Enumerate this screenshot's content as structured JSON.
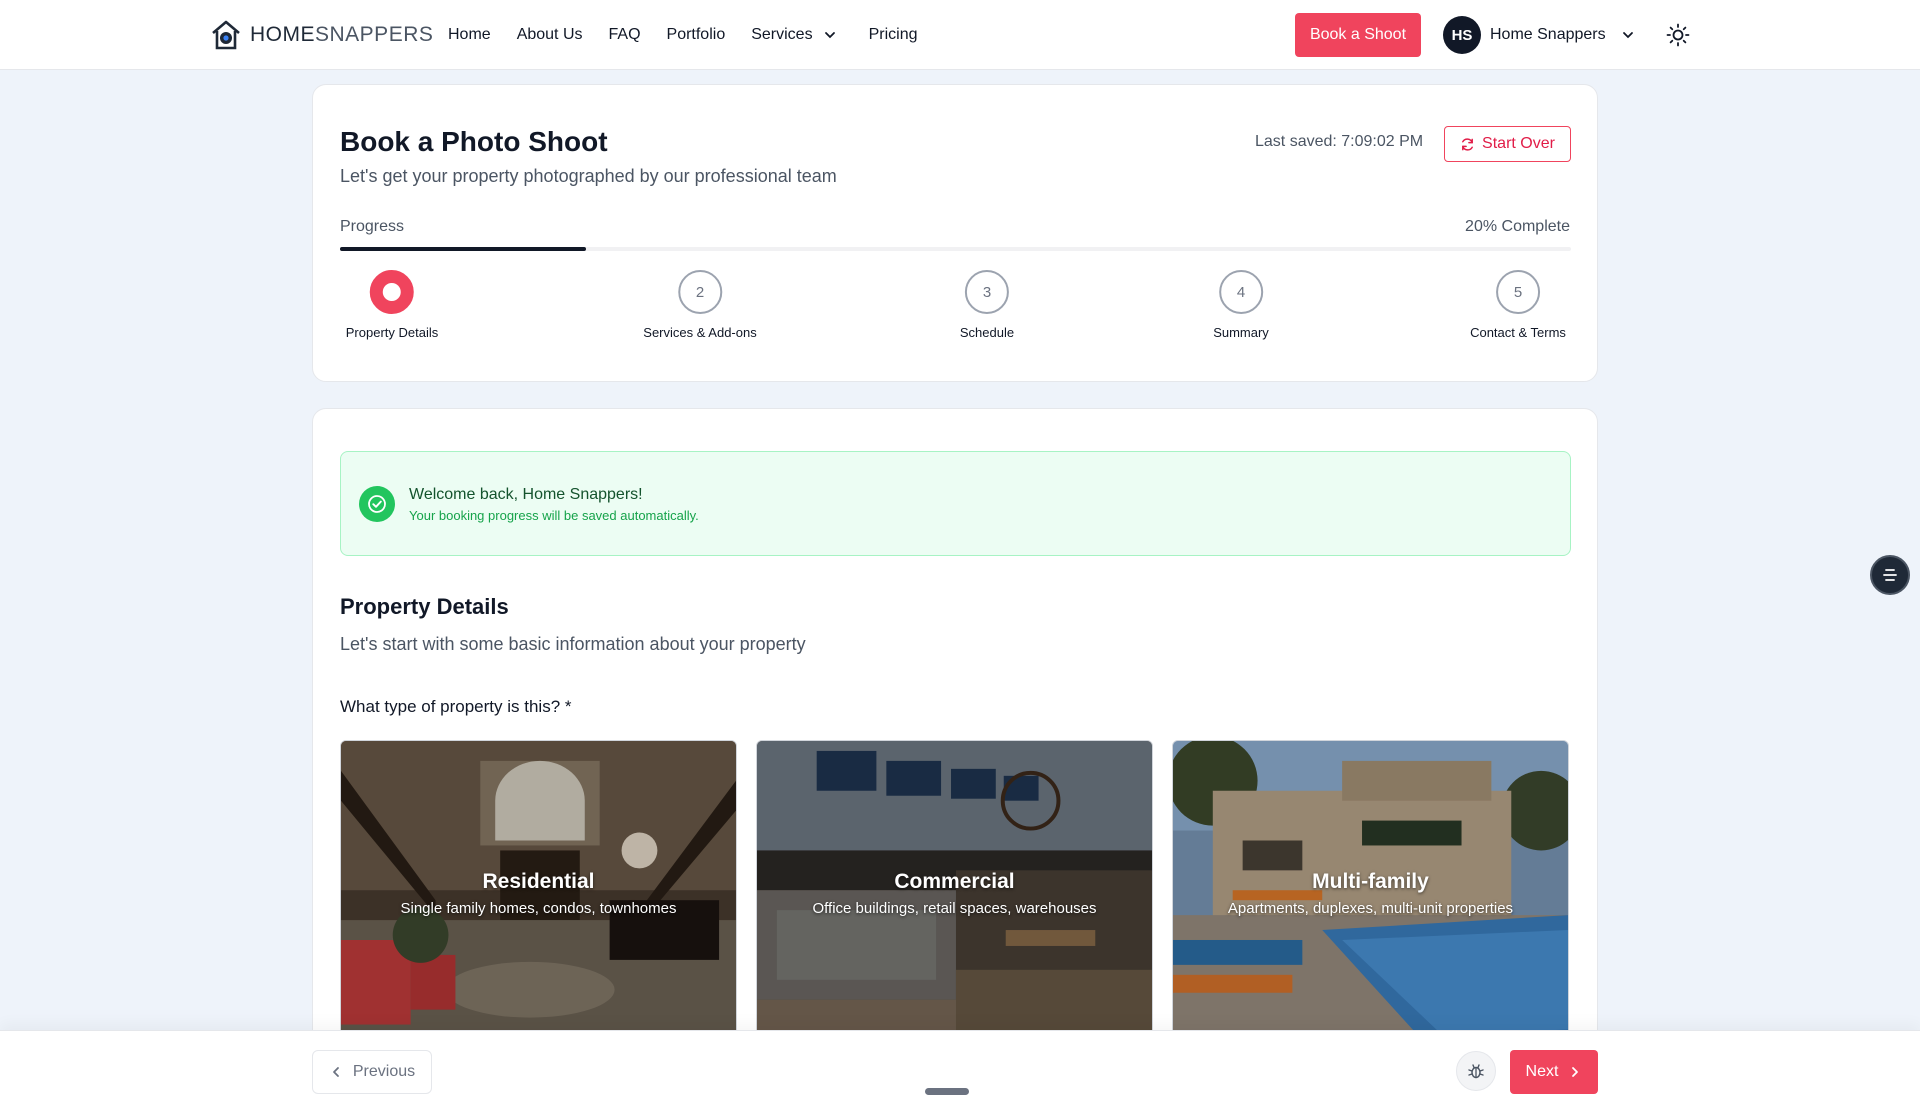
{
  "nav": {
    "logo_bold": "HOME",
    "logo_light": "SNAPPERS",
    "links": [
      "Home",
      "About Us",
      "FAQ",
      "Portfolio",
      "Services",
      "Pricing"
    ],
    "book_label": "Book a Shoot",
    "user_initials": "HS",
    "user_name": "Home Snappers",
    "icons": [
      "logo-icon",
      "chevron-down-icon",
      "sun-icon"
    ]
  },
  "header": {
    "title": "Book a Photo Shoot",
    "subtitle": "Let's get your property photographed by our professional team",
    "last_saved": "Last saved: 7:09:02 PM",
    "start_over": "Start Over",
    "progress_label": "Progress",
    "progress_percent": "20% Complete",
    "progress_value": 0.2
  },
  "steps": [
    {
      "number": "1",
      "label": "Property Details",
      "state": "active"
    },
    {
      "number": "2",
      "label": "Services & Add-ons",
      "state": "pending"
    },
    {
      "number": "3",
      "label": "Schedule",
      "state": "pending"
    },
    {
      "number": "4",
      "label": "Summary",
      "state": "pending"
    },
    {
      "number": "5",
      "label": "Contact & Terms",
      "state": "pending"
    }
  ],
  "welcome": {
    "title": "Welcome back, Home Snappers!",
    "subtitle": "Your booking progress will be saved automatically."
  },
  "section": {
    "title": "Property Details",
    "subtitle": "Let's start with some basic information about your property",
    "question": "What type of property is this? *"
  },
  "property_types": [
    {
      "title": "Residential",
      "description": "Single family homes, condos, townhomes"
    },
    {
      "title": "Commercial",
      "description": "Office buildings, retail spaces, warehouses"
    },
    {
      "title": "Multi-family",
      "description": "Apartments, duplexes, multi-unit properties"
    }
  ],
  "footer": {
    "previous": "Previous",
    "next": "Next"
  },
  "colors": {
    "accent": "#f0445d",
    "success": "#22c55e",
    "background": "#eef3fa",
    "text": "#111827"
  }
}
